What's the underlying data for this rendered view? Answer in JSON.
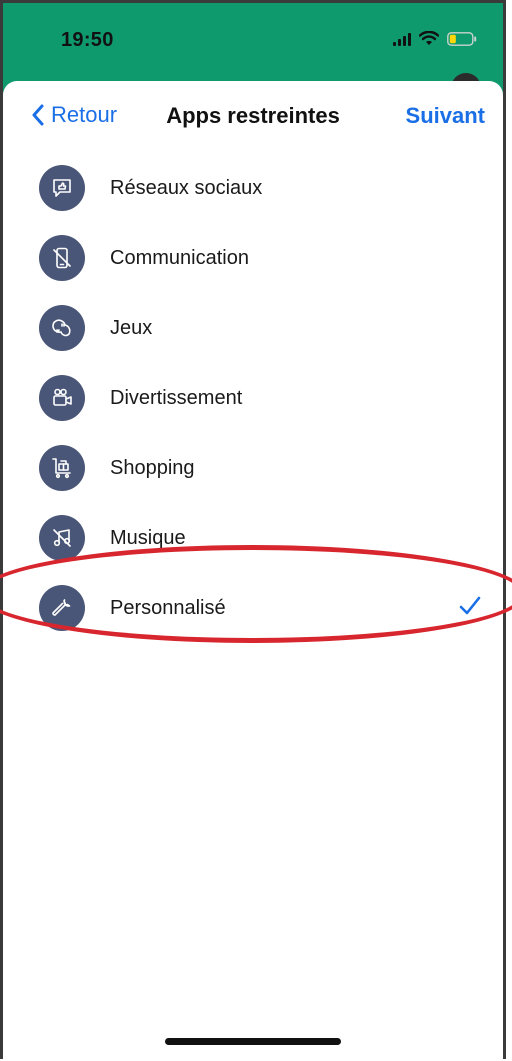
{
  "status_bar": {
    "time": "19:50"
  },
  "nav": {
    "back_label": "Retour",
    "title": "Apps restreintes",
    "next_label": "Suivant"
  },
  "categories": [
    {
      "label": "Réseaux sociaux",
      "icon": "social-icon",
      "selected": false
    },
    {
      "label": "Communication",
      "icon": "phone-off-icon",
      "selected": false
    },
    {
      "label": "Jeux",
      "icon": "gamepad-icon",
      "selected": false
    },
    {
      "label": "Divertissement",
      "icon": "video-camera-icon",
      "selected": false
    },
    {
      "label": "Shopping",
      "icon": "cart-icon",
      "selected": false
    },
    {
      "label": "Musique",
      "icon": "music-off-icon",
      "selected": false
    },
    {
      "label": "Personnalisé",
      "icon": "wrench-icon",
      "selected": true
    }
  ],
  "colors": {
    "status_bg": "#0f9a6e",
    "accent": "#1a6fe6",
    "icon_bg": "#4a5677",
    "highlight": "#d8262e"
  }
}
